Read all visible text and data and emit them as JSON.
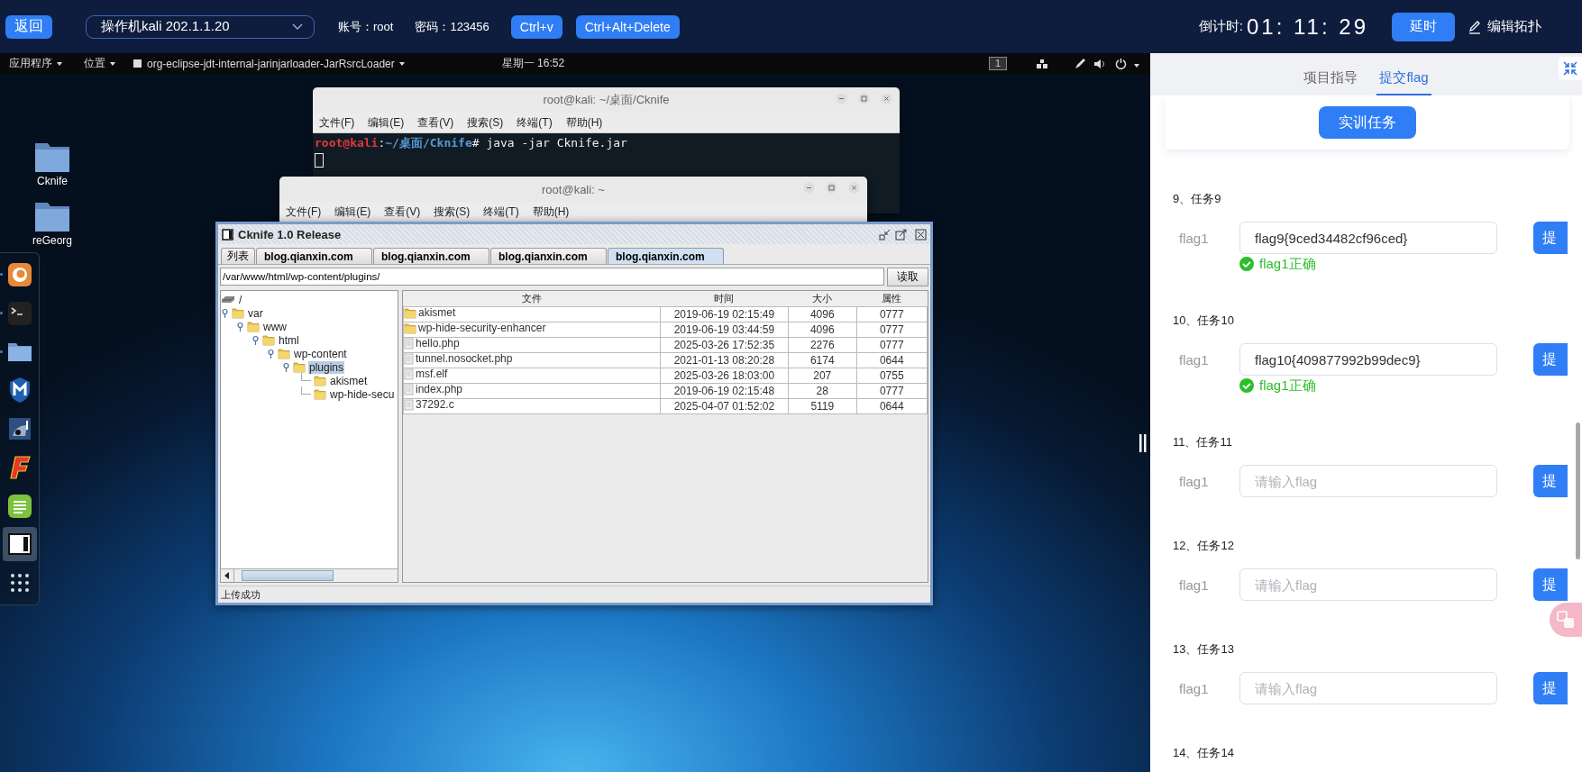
{
  "top_bar": {
    "back_button": "返回",
    "machine_select": {
      "value": "操作机kali 202.1.1.20"
    },
    "account": "账号：root",
    "password": "密码：123456",
    "buttons": [
      "Ctrl+v",
      "Ctrl+Alt+Delete"
    ],
    "countdown_label": "倒计时:",
    "countdown": "01: 11: 29",
    "delay_button": "延时",
    "edit_topology": "编辑拓扑"
  },
  "remote_desktop": {
    "panel_bar": {
      "menus": [
        "应用程序",
        "位置"
      ],
      "active_app": "org-eclipse-jdt-internal-jarinjarloader-JarRsrcLoader",
      "clock": "星期一 16:52",
      "workspace": "1"
    },
    "desktop_icons": [
      {
        "label": "Cknife"
      },
      {
        "label": "reGeorg"
      }
    ],
    "dock": [
      {
        "kind": "browser",
        "running": true,
        "selected": false
      },
      {
        "kind": "terminal",
        "running": true,
        "selected": false
      },
      {
        "kind": "files",
        "running": true,
        "selected": false
      },
      {
        "kind": "shield",
        "running": false,
        "selected": false
      },
      {
        "kind": "mascot",
        "running": false,
        "selected": false
      },
      {
        "kind": "red-logo",
        "running": false,
        "selected": false
      },
      {
        "kind": "notes",
        "running": false,
        "selected": false
      },
      {
        "kind": "window",
        "running": false,
        "selected": true
      },
      {
        "kind": "apps",
        "running": false,
        "selected": false
      }
    ],
    "terminals": [
      {
        "title": "root@kali: ~/桌面/Cknife",
        "menu": [
          "文件(F)",
          "编辑(E)",
          "查看(V)",
          "搜索(S)",
          "终端(T)",
          "帮助(H)"
        ],
        "prompt_user": "root@kali",
        "prompt_sep": ":",
        "prompt_path": "~/桌面/Cknife",
        "command": "# java -jar Cknife.jar"
      },
      {
        "title": "root@kali: ~",
        "menu": [
          "文件(F)",
          "编辑(E)",
          "查看(V)",
          "搜索(S)",
          "终端(T)",
          "帮助(H)"
        ]
      }
    ],
    "cknife": {
      "title": "Cknife 1.0 Release",
      "tabs": [
        {
          "label": "列表",
          "selected": false
        },
        {
          "label": "blog.qianxin.com",
          "selected": false
        },
        {
          "label": "blog.qianxin.com",
          "selected": false
        },
        {
          "label": "blog.qianxin.com",
          "selected": false
        },
        {
          "label": "blog.qianxin.com",
          "selected": true
        }
      ],
      "path": "/var/www/html/wp-content/plugins/",
      "read_button": "读取",
      "tree": {
        "label": "/",
        "selected": false,
        "children": [
          {
            "label": "var",
            "selected": false,
            "children": [
              {
                "label": "www",
                "selected": false,
                "children": [
                  {
                    "label": "html",
                    "selected": false,
                    "children": [
                      {
                        "label": "wp-content",
                        "selected": false,
                        "children": [
                          {
                            "label": "plugins",
                            "selected": true,
                            "children": [
                              {
                                "label": "akismet",
                                "selected": false
                              },
                              {
                                "label": "wp-hide-secu",
                                "selected": false
                              }
                            ]
                          }
                        ]
                      }
                    ]
                  }
                ]
              }
            ]
          }
        ]
      },
      "table": {
        "columns": [
          "文件",
          "时间",
          "大小",
          "属性"
        ],
        "rows": [
          {
            "kind": "folder",
            "cells": [
              "akismet",
              "2019-06-19 02:15:49",
              "4096",
              "0777"
            ]
          },
          {
            "kind": "folder",
            "cells": [
              "wp-hide-security-enhancer",
              "2019-06-19 03:44:59",
              "4096",
              "0777"
            ]
          },
          {
            "kind": "file",
            "cells": [
              "hello.php",
              "2025-03-26 17:52:35",
              "2276",
              "0777"
            ]
          },
          {
            "kind": "file",
            "cells": [
              "tunnel.nosocket.php",
              "2021-01-13 08:20:28",
              "6174",
              "0644"
            ]
          },
          {
            "kind": "file",
            "cells": [
              "msf.elf",
              "2025-03-26 18:03:00",
              "207",
              "0755"
            ]
          },
          {
            "kind": "file",
            "cells": [
              "index.php",
              "2019-06-19 02:15:48",
              "28",
              "0777"
            ]
          },
          {
            "kind": "file",
            "cells": [
              "37292.c",
              "2025-04-07 01:52:02",
              "5119",
              "0644"
            ]
          }
        ]
      },
      "status": "上传成功"
    }
  },
  "side_panel": {
    "tabs": [
      {
        "label": "项目指导",
        "selected": false
      },
      {
        "label": "提交flag",
        "selected": true
      }
    ],
    "task_button": "实训任务",
    "tasks": [
      {
        "title": "9、任务9",
        "fields": [
          {
            "label": "flag1",
            "value": "flag9{9ced34482cf96ced}",
            "result": "flag1正确"
          }
        ],
        "submit": "提"
      },
      {
        "title": "10、任务10",
        "fields": [
          {
            "label": "flag1",
            "value": "flag10{409877992b99dec9}",
            "result": "flag1正确"
          }
        ],
        "submit": "提"
      },
      {
        "title": "11、任务11",
        "fields": [
          {
            "label": "flag1",
            "placeholder": "请输入flag"
          }
        ],
        "submit": "提"
      },
      {
        "title": "12、任务12",
        "fields": [
          {
            "label": "flag1",
            "placeholder": "请输入flag"
          }
        ],
        "submit": "提"
      },
      {
        "title": "13、任务13",
        "fields": [
          {
            "label": "flag1",
            "placeholder": "请输入flag"
          }
        ],
        "submit": "提"
      },
      {
        "title": "14、任务14"
      }
    ]
  }
}
